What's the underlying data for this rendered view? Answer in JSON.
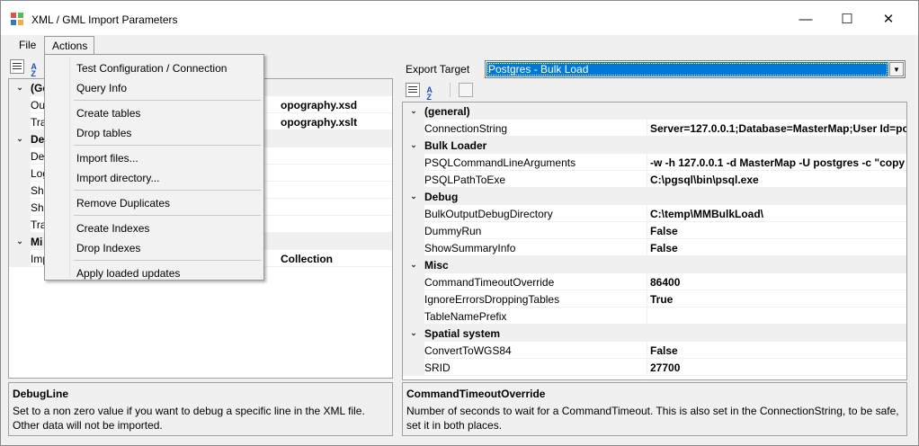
{
  "window": {
    "title": "XML / GML Import Parameters",
    "minimize_glyph": "—",
    "maximize_glyph": "☐",
    "close_glyph": "✕"
  },
  "menubar": {
    "file": "File",
    "actions": "Actions"
  },
  "actions_menu": {
    "items": [
      "Test Configuration / Connection",
      "Query Info",
      "Create tables",
      "Drop tables",
      "Import files...",
      "Import directory...",
      "Remove Duplicates",
      "Create Indexes",
      "Drop Indexes",
      "Apply loaded updates"
    ]
  },
  "left_grid": {
    "rows": [
      {
        "type": "cat",
        "name": "(Ge",
        "toggle": "⌄"
      },
      {
        "type": "prop",
        "name": "Ou",
        "value": "opography.xsd"
      },
      {
        "type": "prop",
        "name": "Tra",
        "value": "opography.xslt"
      },
      {
        "type": "cat",
        "name": "De",
        "toggle": "⌄"
      },
      {
        "type": "prop",
        "name": "De",
        "value": ""
      },
      {
        "type": "prop",
        "name": "Log",
        "value": ""
      },
      {
        "type": "prop",
        "name": "Sho",
        "value": ""
      },
      {
        "type": "prop",
        "name": "Sho",
        "value": ""
      },
      {
        "type": "prop",
        "name": "Tra",
        "value": ""
      },
      {
        "type": "cat",
        "name": "Mi",
        "toggle": "⌄"
      },
      {
        "type": "prop",
        "name": "Imp",
        "value": "Collection"
      }
    ]
  },
  "left_help": {
    "title": "DebugLine",
    "text": "Set to a non zero value if you want to debug a specific line in the XML file. Other data will not be imported."
  },
  "export_target": {
    "label": "Export Target",
    "value": "Postgres - Bulk Load",
    "arrow": "▼"
  },
  "right_grid": {
    "rows": [
      {
        "type": "cat",
        "name": "(general)",
        "toggle": "⌄"
      },
      {
        "type": "prop",
        "name": "ConnectionString",
        "value": "Server=127.0.0.1;Database=MasterMap;User Id=po"
      },
      {
        "type": "cat",
        "name": "Bulk Loader",
        "toggle": "⌄"
      },
      {
        "type": "prop",
        "name": "PSQLCommandLineArguments",
        "value": "-w -h 127.0.0.1 -d MasterMap -U postgres -c \"copy"
      },
      {
        "type": "prop",
        "name": "PSQLPathToExe",
        "value": "C:\\pgsql\\bin\\psql.exe"
      },
      {
        "type": "cat",
        "name": "Debug",
        "toggle": "⌄"
      },
      {
        "type": "prop",
        "name": "BulkOutputDebugDirectory",
        "value": "C:\\temp\\MMBulkLoad\\"
      },
      {
        "type": "prop",
        "name": "DummyRun",
        "value": "False"
      },
      {
        "type": "prop",
        "name": "ShowSummaryInfo",
        "value": "False"
      },
      {
        "type": "cat",
        "name": "Misc",
        "toggle": "⌄"
      },
      {
        "type": "prop",
        "name": "CommandTimeoutOverride",
        "value": "86400"
      },
      {
        "type": "prop",
        "name": "IgnoreErrorsDroppingTables",
        "value": "True"
      },
      {
        "type": "prop",
        "name": "TableNamePrefix",
        "value": ""
      },
      {
        "type": "cat",
        "name": "Spatial system",
        "toggle": "⌄"
      },
      {
        "type": "prop",
        "name": "ConvertToWGS84",
        "value": "False"
      },
      {
        "type": "prop",
        "name": "SRID",
        "value": "27700"
      }
    ]
  },
  "right_help": {
    "title": "CommandTimeoutOverride",
    "text": "Number of seconds to wait for a CommandTimeout.  This is also set in the ConnectionString, to be safe, set it in both places."
  },
  "toolbar": {
    "sort_label": "A\nZ"
  },
  "colors": {
    "selection": "#0078d7",
    "panel_bg": "#f0f0f0",
    "grid_bg": "#ffffff"
  }
}
